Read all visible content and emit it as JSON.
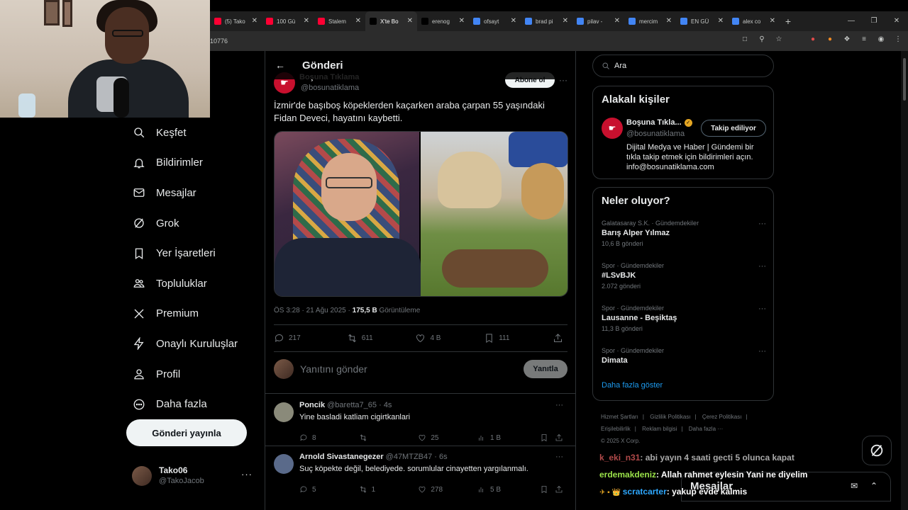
{
  "browser": {
    "tabs": [
      {
        "label": "(5) Tako",
        "favicon_color": "#ff0033"
      },
      {
        "label": "100 Gü",
        "favicon_color": "#ff0033"
      },
      {
        "label": "Stalem",
        "favicon_color": "#ff0033"
      },
      {
        "label": "X'te Bo",
        "favicon_color": "#000000",
        "active": true
      },
      {
        "label": "erenog",
        "favicon_color": "#000000"
      },
      {
        "label": "ofsayt",
        "favicon_color": "#4285f4"
      },
      {
        "label": "brad pi",
        "favicon_color": "#4285f4"
      },
      {
        "label": "pilav -",
        "favicon_color": "#4285f4"
      },
      {
        "label": "mercim",
        "favicon_color": "#4285f4"
      },
      {
        "label": "EN GÜ",
        "favicon_color": "#4285f4"
      },
      {
        "label": "alex co",
        "favicon_color": "#4285f4"
      }
    ],
    "address_fragment": "10776",
    "new_tab_label": "+"
  },
  "nav": {
    "items": [
      {
        "key": "explore",
        "label": "Keşfet"
      },
      {
        "key": "notifications",
        "label": "Bildirimler"
      },
      {
        "key": "messages",
        "label": "Mesajlar"
      },
      {
        "key": "grok",
        "label": "Grok"
      },
      {
        "key": "bookmarks",
        "label": "Yer İşaretleri"
      },
      {
        "key": "communities",
        "label": "Topluluklar"
      },
      {
        "key": "premium",
        "label": "Premium"
      },
      {
        "key": "verified-orgs",
        "label": "Onaylı Kuruluşlar"
      },
      {
        "key": "profile",
        "label": "Profil"
      },
      {
        "key": "more",
        "label": "Daha fazla"
      }
    ],
    "post_button": "Gönderi yayınla",
    "account": {
      "name": "Tako06",
      "handle": "@TakoJacob",
      "more": "···"
    }
  },
  "post": {
    "header_title": "Gönderi",
    "author_name": "Boşuna Tıklama",
    "author_handle": "@bosunatiklama",
    "subscribe_label": "Abone ol",
    "text": "İzmir'de başıboş köpeklerden kaçarken araba çarpan 55 yaşındaki Fidan Deveci, hayatını kaybetti.",
    "time": "ÖS 3:28 · 21 Ağu 2025 · ",
    "views": "175,5 B",
    "views_label": " Görüntüleme",
    "stats": {
      "replies": "217",
      "reposts": "611",
      "likes": "4 B",
      "bookmarks": "111"
    },
    "reply_placeholder": "Yanıtını gönder",
    "reply_button": "Yanıtla"
  },
  "replies": [
    {
      "name": "Poncik",
      "handle": "@baretta7_65",
      "time": "· 4s",
      "text": "Yine basladi katliam cigirtkanlari",
      "replies": "8",
      "reposts": "",
      "likes": "25",
      "views": "1 B",
      "avatar_color": "#8a8a7a"
    },
    {
      "name": "Arnold Sivastanegezer",
      "handle": "@47MTZB47",
      "time": "· 6s",
      "text": "Suç köpekte değil, belediyede. sorumlular cinayetten yargılanmalı.",
      "replies": "5",
      "reposts": "1",
      "likes": "278",
      "views": "5 B",
      "avatar_color": "#5a6a8a"
    }
  ],
  "search": {
    "placeholder": "Ara"
  },
  "related": {
    "title": "Alakalı kişiler",
    "name": "Boşuna Tıkla...",
    "handle": "@bosunatiklama",
    "follow_label": "Takip ediliyor",
    "bio": "Dijital Medya ve Haber | Gündemi bir tıkla takip etmek için bildirimleri açın. info@bosunatiklama.com"
  },
  "trends": {
    "title": "Neler oluyor?",
    "items": [
      {
        "category": "Galatasaray S.K. · Gündemdekiler",
        "name": "Barış Alper Yılmaz",
        "count": "10,6 B gönderi"
      },
      {
        "category": "Spor · Gündemdekiler",
        "name": "#LSvBJK",
        "count": "2.072 gönderi"
      },
      {
        "category": "Spor · Gündemdekiler",
        "name": "Lausanne - Beşiktaş",
        "count": "11,3 B gönderi"
      },
      {
        "category": "Spor · Gündemdekiler",
        "name": "Dimata",
        "count": ""
      }
    ],
    "show_more": "Daha fazla göster"
  },
  "footer": {
    "links": [
      "Hizmet Şartları",
      "|",
      "Gizlilik Politikası",
      "|",
      "Çerez Politikası",
      "|",
      "Erişilebilirlik",
      "|",
      "Reklam bilgisi",
      "|",
      "Daha fazla ···"
    ],
    "copyright": "© 2025 X Corp."
  },
  "chat": [
    {
      "user": "k_eki_n31",
      "color": "#b14a4a",
      "message": ": abi yayın 4 saati gecti 5 olunca kapat",
      "prefix": ""
    },
    {
      "user": "erdemakdeniz",
      "color": "#9be34a",
      "message": ": Allah rahmet eylesin Yani ne diyelim",
      "prefix": ""
    },
    {
      "user": "scratcarter",
      "color": "#2ea8ff",
      "message": ": yakup evde kalmis",
      "prefix": "✈ ▪ 👑 "
    }
  ],
  "messages_bar": {
    "title": "Mesajlar"
  },
  "colors": {
    "accent": "#1d9bf0",
    "background": "#000000",
    "border": "#2f3336",
    "muted": "#71767b"
  }
}
